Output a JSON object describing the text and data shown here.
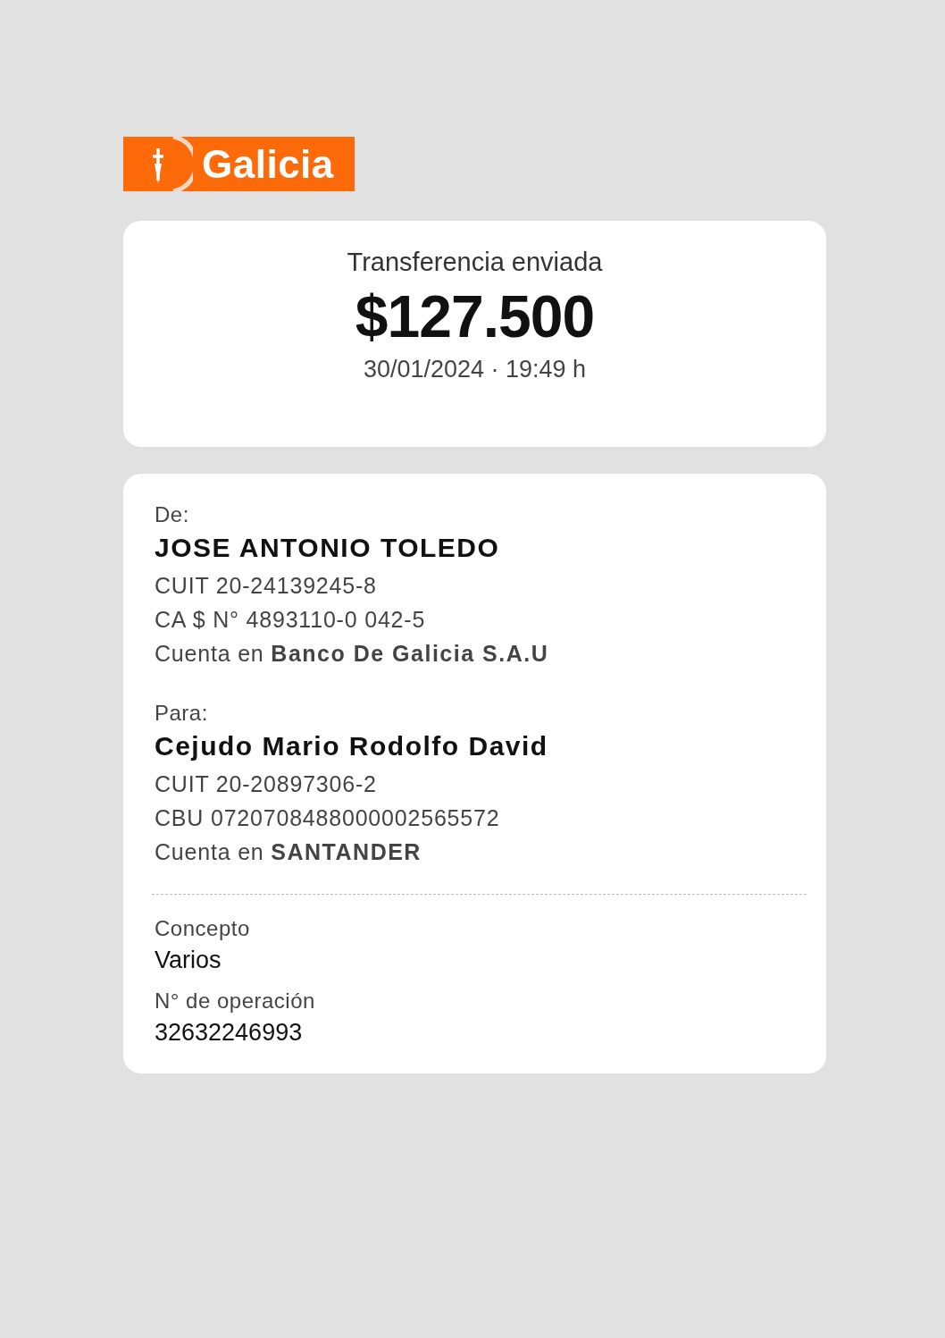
{
  "logo": {
    "text": "Galicia"
  },
  "summary": {
    "title": "Transferencia enviada",
    "amount": "$127.500",
    "datetime": "30/01/2024 · 19:49 h"
  },
  "parties": [
    {
      "label": "De:",
      "name": "JOSE ANTONIO TOLEDO",
      "lines": [
        "CUIT 20-24139245-8",
        "CA $ N° 4893110-0 042-5",
        "Cuenta en **Banco De Galicia S.A.U**"
      ]
    },
    {
      "label": "Para:",
      "name": "Cejudo Mario Rodolfo David",
      "lines": [
        "CUIT 20-20897306-2",
        "CBU 0720708488000002565572",
        "Cuenta en **SANTANDER**"
      ]
    }
  ],
  "details": [
    {
      "label": "Concepto",
      "value": "Varios"
    },
    {
      "label": "N° de operación",
      "value": "32632246993"
    }
  ]
}
